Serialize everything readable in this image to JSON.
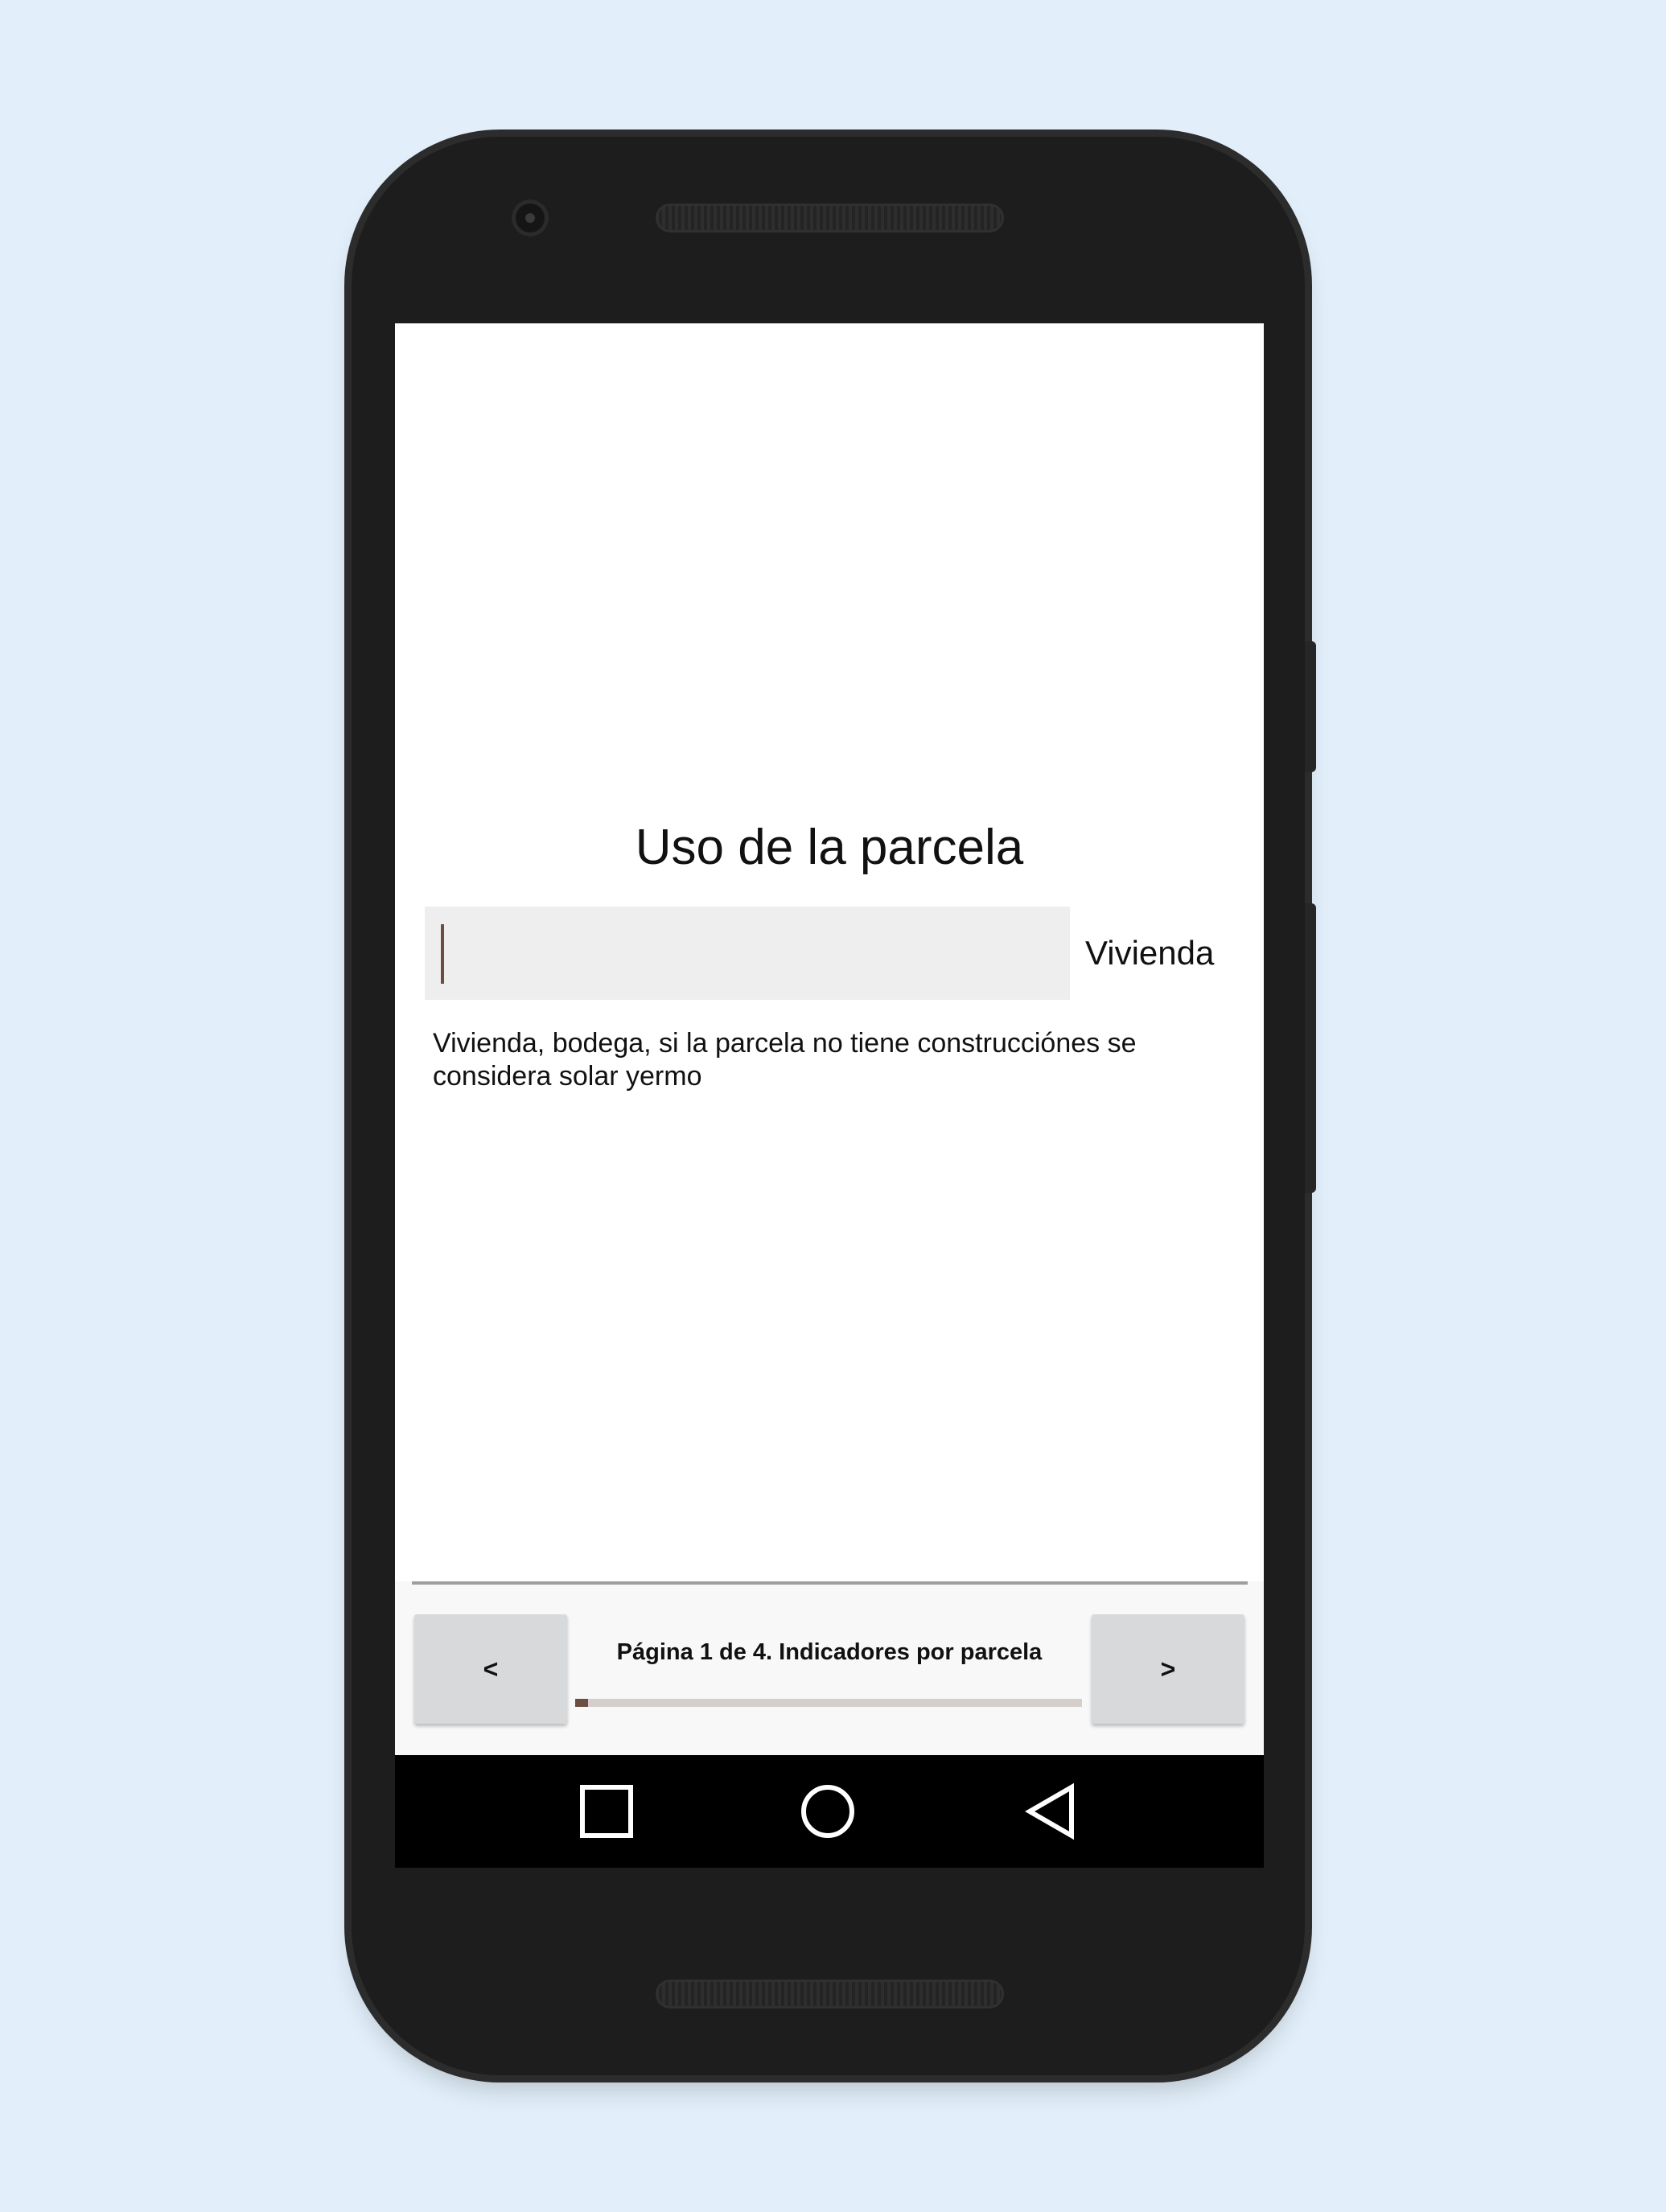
{
  "form": {
    "title": "Uso de la parcela",
    "input_value": "",
    "input_placeholder": "",
    "value_label": "Vivienda",
    "hint": "Vivienda, bodega, si la parcela no tiene construcciónes se considera solar yermo"
  },
  "footer": {
    "prev_label": "<",
    "next_label": ">",
    "page_label": "Página 1 de 4. Indicadores por parcela",
    "progress_fraction": 0.025
  },
  "system_nav": {
    "recents_icon": "square-icon",
    "home_icon": "circle-icon",
    "back_icon": "triangle-back-icon"
  },
  "colors": {
    "accent": "#6d4c41",
    "background": "#e2effa",
    "button": "#d7d9da"
  }
}
